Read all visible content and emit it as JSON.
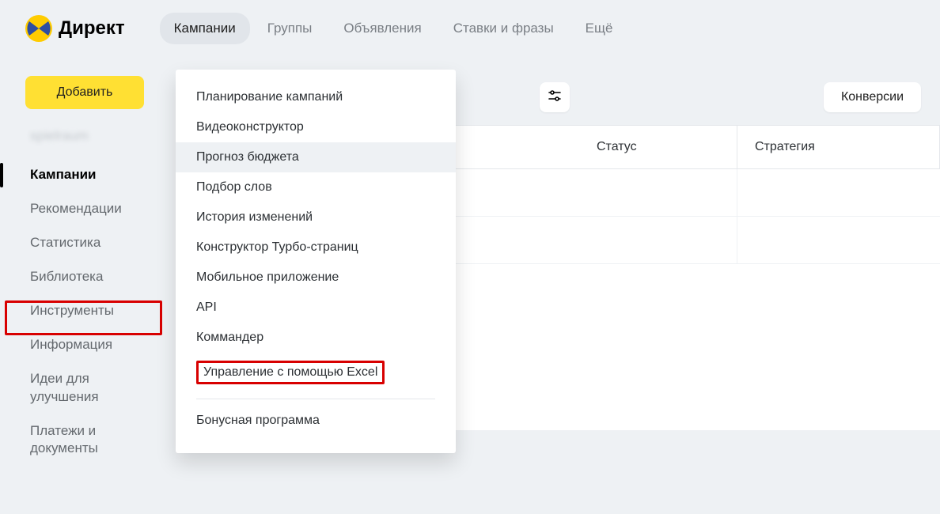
{
  "logo": {
    "text": "Директ"
  },
  "tabs": [
    {
      "label": "Кампании",
      "active": true
    },
    {
      "label": "Группы",
      "active": false
    },
    {
      "label": "Объявления",
      "active": false
    },
    {
      "label": "Ставки и фразы",
      "active": false
    },
    {
      "label": "Ещё",
      "active": false
    }
  ],
  "sidebar": {
    "add_button": "Добавить",
    "blurred_account": "spielraum",
    "items": [
      {
        "label": "Кампании",
        "active": true
      },
      {
        "label": "Рекомендации",
        "active": false
      },
      {
        "label": "Статистика",
        "active": false
      },
      {
        "label": "Библиотека",
        "active": false
      },
      {
        "label": "Инструменты",
        "active": false,
        "highlighted": true
      },
      {
        "label": "Информация",
        "active": false
      },
      {
        "label": "Идеи для\nулучшения",
        "active": false
      },
      {
        "label": "Платежи и\nдокументы",
        "active": false
      }
    ]
  },
  "dropdown": {
    "items": [
      {
        "label": "Планирование кампаний"
      },
      {
        "label": "Видеоконструктор"
      },
      {
        "label": "Прогноз бюджета",
        "hover": true
      },
      {
        "label": "Подбор слов"
      },
      {
        "label": "История изменений"
      },
      {
        "label": "Конструктор Турбо-страниц"
      },
      {
        "label": "Мобильное приложение"
      },
      {
        "label": "API"
      },
      {
        "label": "Коммандер"
      },
      {
        "label": "Управление с помощью Excel",
        "highlighted": true
      }
    ],
    "last": {
      "label": "Бонусная программа"
    }
  },
  "toolbar": {
    "settings_icon": "settings-sliders-icon",
    "conversions_button": "Конверсии"
  },
  "table": {
    "headers": {
      "status": "Статус",
      "strategy": "Стратегия"
    }
  }
}
